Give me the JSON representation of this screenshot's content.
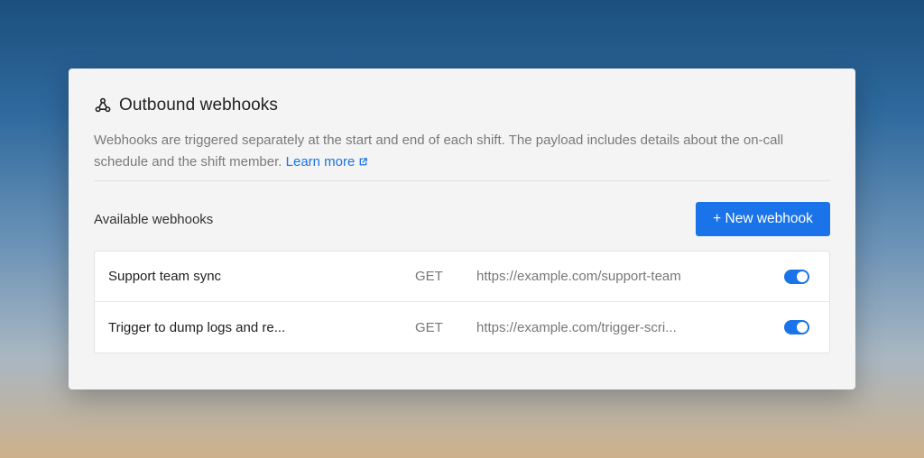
{
  "panel": {
    "title": "Outbound webhooks",
    "icon": "webhook-icon",
    "description": "Webhooks are triggered separately at the start and end of each shift. The payload includes details about the on-call schedule and the shift member.",
    "learn_more": "Learn more"
  },
  "list": {
    "label": "Available webhooks",
    "new_button": "+ New webhook",
    "rows": [
      {
        "name": "Support team sync",
        "method": "GET",
        "url": "https://example.com/support-team",
        "enabled": true
      },
      {
        "name": "Trigger to dump logs and re...",
        "method": "GET",
        "url": "https://example.com/trigger-scri...",
        "enabled": true
      }
    ]
  },
  "colors": {
    "accent": "#1a73e8",
    "card_bg": "#f4f4f4"
  }
}
